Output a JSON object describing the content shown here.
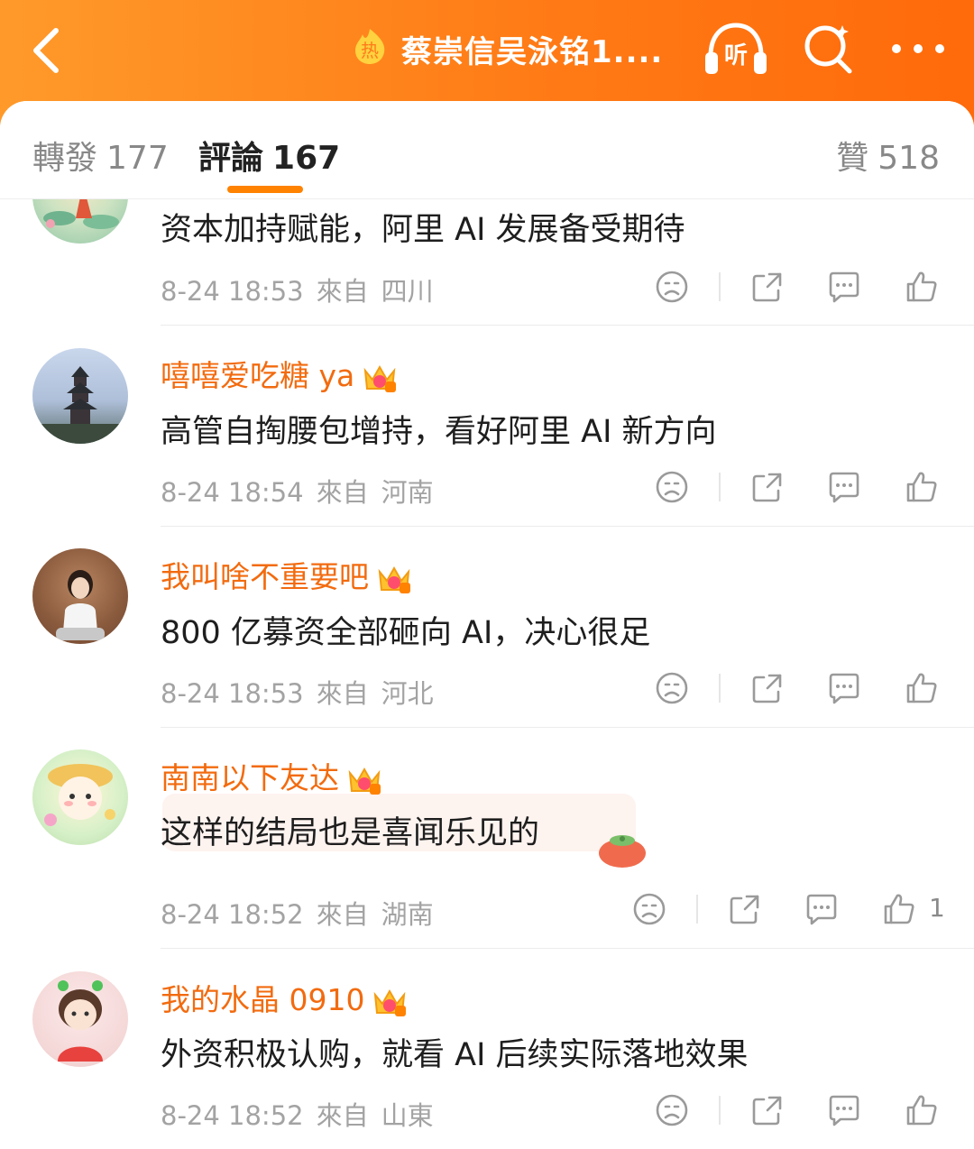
{
  "header": {
    "back_icon": "chevron-left-icon",
    "hot_badge_text": "热",
    "title": "蔡崇信吴泳铭1....",
    "listen_label": "听",
    "search_icon": "search-icon",
    "more_icon": "more-dots-icon"
  },
  "tabs": {
    "repost": {
      "label": "轉發",
      "count": "177"
    },
    "comment": {
      "label": "評論",
      "count": "167"
    },
    "like": {
      "label": "贊",
      "count": "518"
    }
  },
  "comments": [
    {
      "username": "",
      "content": "资本加持赋能，阿里 AI 发展备受期待",
      "time": "8-24 18:53",
      "from": "來自",
      "location": "四川",
      "likes": ""
    },
    {
      "username": "嘻嘻爱吃糖 ya",
      "badge_level": "5",
      "content": "高管自掏腰包增持，看好阿里 AI 新方向",
      "time": "8-24 18:54",
      "from": "來自",
      "location": "河南",
      "likes": ""
    },
    {
      "username": "我叫啥不重要吧",
      "badge_level": "4",
      "content": "800 亿募资全部砸向 AI，决心很足",
      "time": "8-24 18:53",
      "from": "來自",
      "location": "河北",
      "likes": ""
    },
    {
      "username": "南南以下友达",
      "badge_level": "5",
      "content": "这样的结局也是喜闻乐见的",
      "time": "8-24 18:52",
      "from": "來自",
      "location": "湖南",
      "likes": "1"
    },
    {
      "username": "我的水晶 0910",
      "badge_level": "5",
      "content": "外资积极认购，就看 AI 后续实际落地效果",
      "time": "8-24 18:52",
      "from": "來自",
      "location": "山東",
      "likes": ""
    }
  ],
  "colors": {
    "brand_orange": "#ff8200",
    "username_orange": "#f26b0f"
  }
}
